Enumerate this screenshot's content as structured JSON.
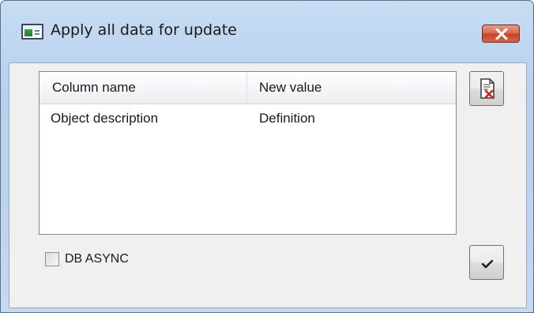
{
  "window": {
    "title": "Apply all data for update",
    "icon": "application-window-icon",
    "close_icon": "close-icon"
  },
  "table": {
    "columns": [
      "Column name",
      "New value"
    ],
    "rows": [
      [
        "Object description",
        "Definition"
      ]
    ]
  },
  "options": {
    "db_async_label": "DB ASYNC",
    "db_async_checked": false
  },
  "buttons": {
    "delete_icon": "delete-document-icon",
    "confirm_icon": "checkmark-icon"
  },
  "colors": {
    "close_button": "#c74428",
    "frame": "#bcd3ef",
    "client_background": "#f0f0f0"
  }
}
